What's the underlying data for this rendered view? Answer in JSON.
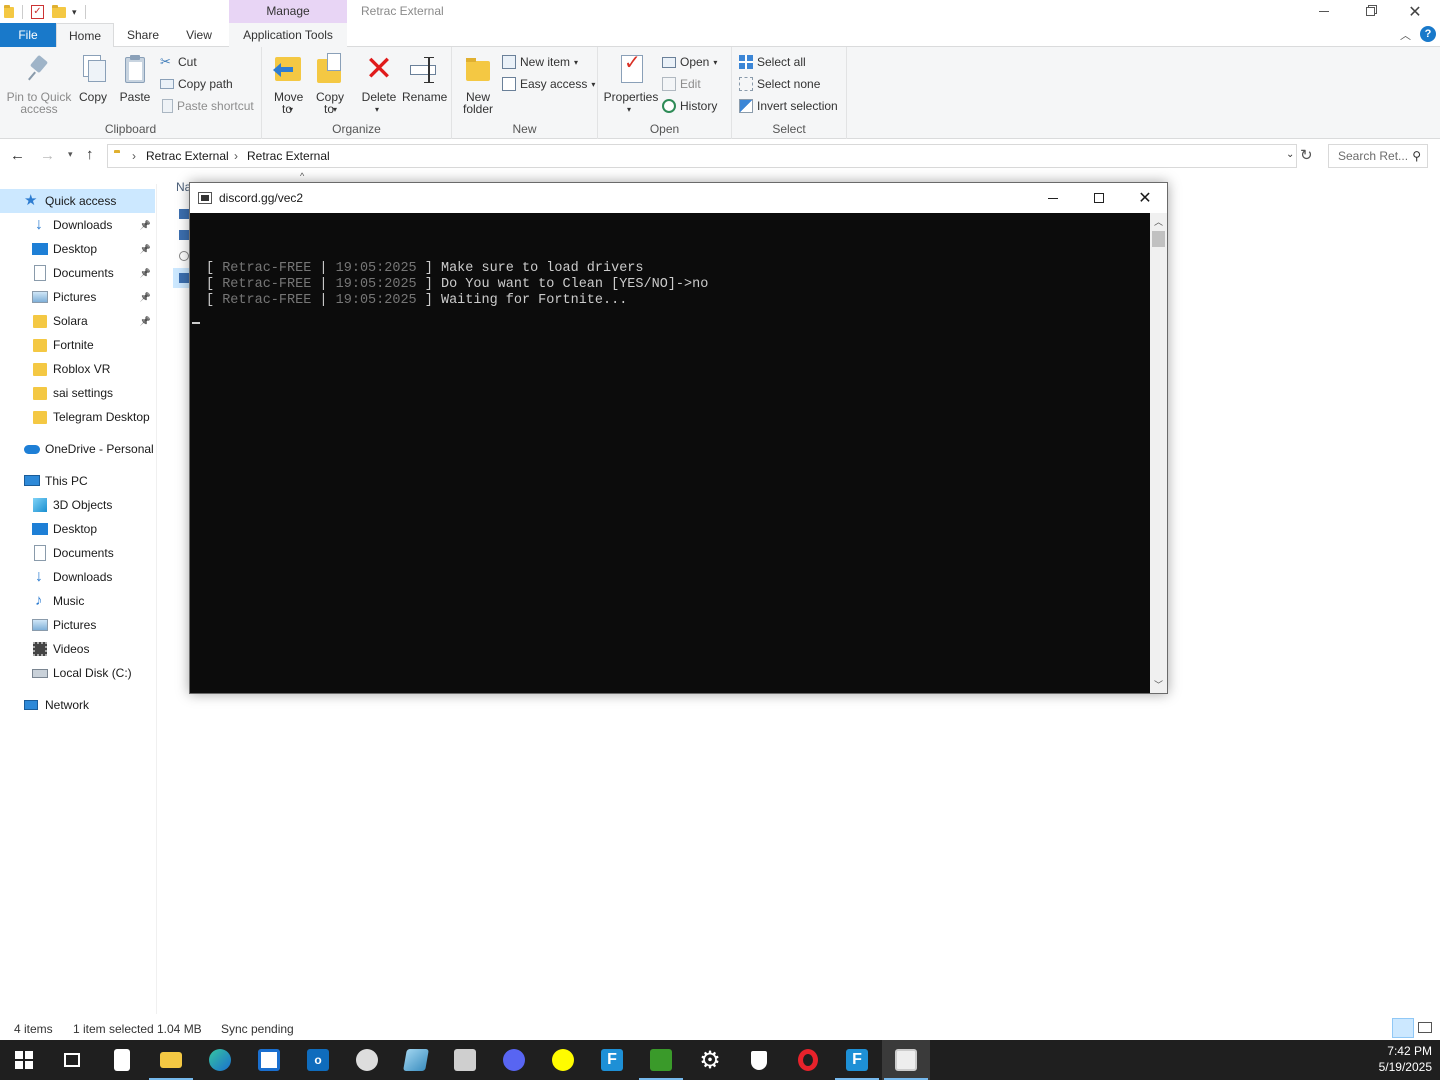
{
  "window": {
    "manage_label": "Manage",
    "title": "Retrac External"
  },
  "tabs": {
    "file": "File",
    "home": "Home",
    "share": "Share",
    "view": "View",
    "app_tools": "Application Tools"
  },
  "ribbon": {
    "clipboard": {
      "label": "Clipboard",
      "pin": "Pin to Quick access",
      "copy": "Copy",
      "paste": "Paste",
      "cut": "Cut",
      "copy_path": "Copy path",
      "paste_shortcut": "Paste shortcut"
    },
    "organize": {
      "label": "Organize",
      "move_to": "Move to",
      "copy_to": "Copy to",
      "delete": "Delete",
      "rename": "Rename"
    },
    "new": {
      "label": "New",
      "new_folder": "New folder",
      "new_item": "New item",
      "easy_access": "Easy access"
    },
    "open": {
      "label": "Open",
      "properties": "Properties",
      "open": "Open",
      "edit": "Edit",
      "history": "History"
    },
    "select": {
      "label": "Select",
      "select_all": "Select all",
      "select_none": "Select none",
      "invert": "Invert selection"
    }
  },
  "address": {
    "crumbs": [
      "Retrac External",
      "Retrac External"
    ],
    "search_placeholder": "Search Ret..."
  },
  "content": {
    "column_name": "Na"
  },
  "nav": {
    "quick_access": "Quick access",
    "quick_items": [
      {
        "label": "Downloads",
        "pinned": true
      },
      {
        "label": "Desktop",
        "pinned": true
      },
      {
        "label": "Documents",
        "pinned": true
      },
      {
        "label": "Pictures",
        "pinned": true
      },
      {
        "label": "Solara",
        "pinned": true
      },
      {
        "label": "Fortnite",
        "pinned": false
      },
      {
        "label": "Roblox VR",
        "pinned": false
      },
      {
        "label": "sai settings",
        "pinned": false
      },
      {
        "label": "Telegram Desktop",
        "pinned": false
      }
    ],
    "onedrive": "OneDrive - Personal",
    "this_pc": "This PC",
    "pc_items": [
      "3D Objects",
      "Desktop",
      "Documents",
      "Downloads",
      "Music",
      "Pictures",
      "Videos",
      "Local Disk (C:)"
    ],
    "network": "Network"
  },
  "status": {
    "items": "4 items",
    "selected": "1 item selected",
    "size": "1.04 MB",
    "sync": "Sync pending"
  },
  "console": {
    "title": "discord.gg/vec2",
    "tag": "Retrac-FREE",
    "time": "19:05:2025",
    "lines": [
      "Make sure to load drivers",
      "Do You want to Clean [YES/NO]->no",
      "Waiting for Fortnite..."
    ]
  },
  "clock": {
    "time": "7:42 PM",
    "date": "5/19/2025"
  },
  "colors": {
    "accent": "#1979ca",
    "manage_tab": "#e8d5f5",
    "taskbar": "#1f1f1f",
    "console_bg": "#0c0c0c"
  }
}
